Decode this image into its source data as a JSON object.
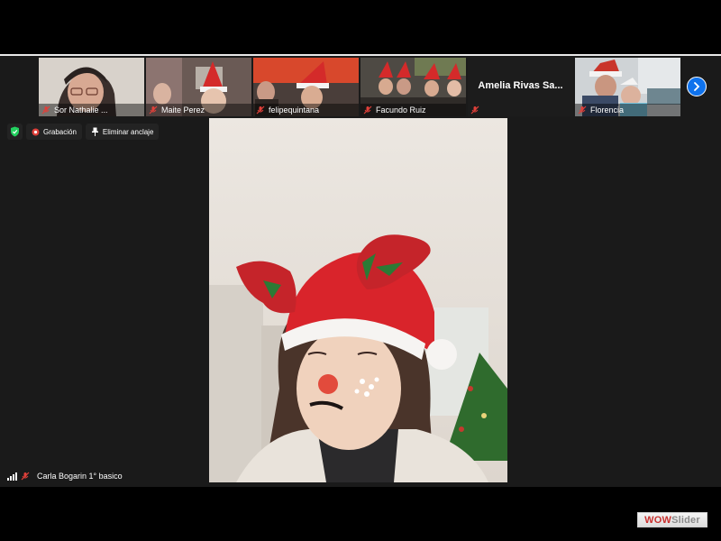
{
  "participants": [
    {
      "name": "Sor Nathalie ...",
      "muted": true
    },
    {
      "name": "Maite Perez",
      "muted": true
    },
    {
      "name": "felipequintana",
      "muted": true
    },
    {
      "name": "Facundo Ruiz",
      "muted": true
    },
    {
      "name": "",
      "display_name": "Amelia Rivas Sa...",
      "muted": true
    },
    {
      "name": "Florencia",
      "muted": true
    }
  ],
  "next_page_icon": "chevron-right-icon",
  "status": {
    "security_icon": "shield-check-icon",
    "recording_label": "Grabación",
    "unpin_label": "Eliminar anclaje"
  },
  "active_speaker": {
    "name": "Carla Bogarin 1° basico",
    "muted": true
  },
  "watermark": {
    "part1": "WOW",
    "part2": "Slider"
  },
  "colors": {
    "accent": "#0e72ed",
    "muted_icon": "#e0403a",
    "security": "#23d160",
    "recording": "#e0403a"
  }
}
